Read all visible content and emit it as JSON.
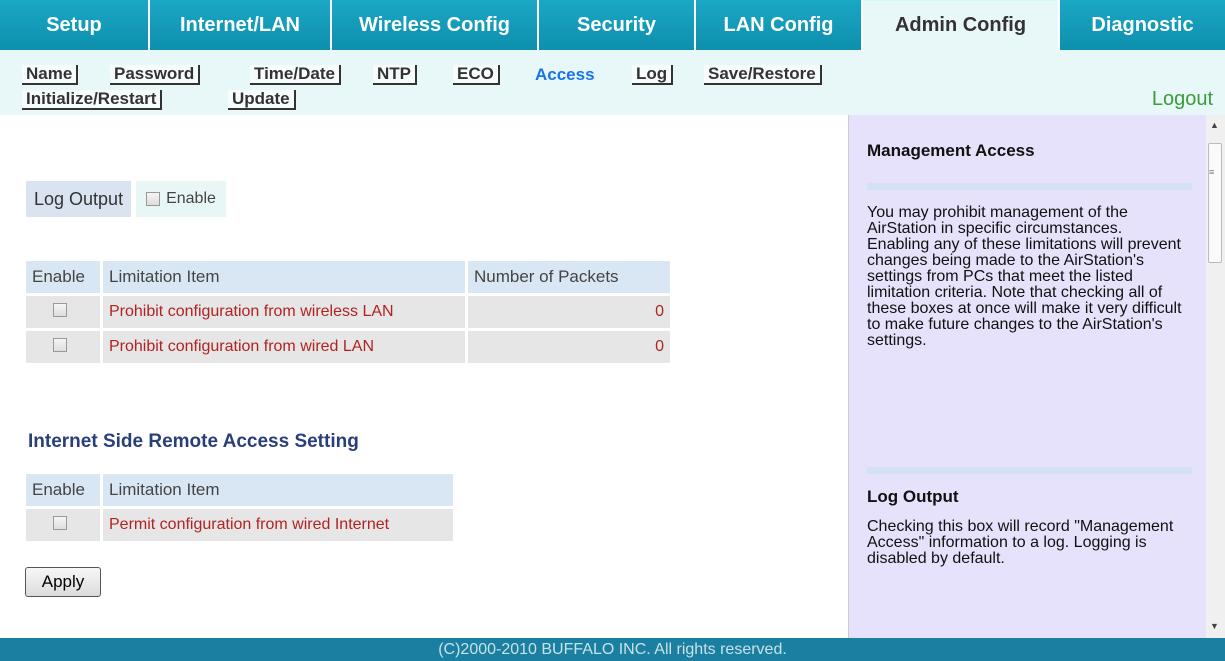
{
  "top_tabs": [
    {
      "label": "Setup"
    },
    {
      "label": "Internet/LAN"
    },
    {
      "label": "Wireless Config"
    },
    {
      "label": "Security"
    },
    {
      "label": "LAN Config"
    },
    {
      "label": "Admin Config",
      "active": true
    },
    {
      "label": "Diagnostic"
    }
  ],
  "sub_tabs": [
    {
      "label": "Name"
    },
    {
      "label": "Password"
    },
    {
      "label": "Time/Date"
    },
    {
      "label": "NTP"
    },
    {
      "label": "ECO"
    },
    {
      "label": "Access",
      "active": true
    },
    {
      "label": "Log"
    },
    {
      "label": "Save/Restore"
    },
    {
      "label": "Initialize/Restart"
    },
    {
      "label": "Update"
    }
  ],
  "logout_label": "Logout",
  "log_output": {
    "label": "Log Output",
    "checkbox_label": "Enable",
    "checked": false
  },
  "limitation_table": {
    "headers": [
      "Enable",
      "Limitation Item",
      "Number of Packets"
    ],
    "rows": [
      {
        "item": "Prohibit configuration from wireless LAN",
        "packets": "0",
        "checked": false
      },
      {
        "item": "Prohibit configuration from wired LAN",
        "packets": "0",
        "checked": false
      }
    ]
  },
  "remote_access": {
    "heading": "Internet Side Remote Access Setting",
    "headers": [
      "Enable",
      "Limitation Item"
    ],
    "rows": [
      {
        "item": "Permit configuration from wired Internet",
        "checked": false
      }
    ]
  },
  "apply_label": "Apply",
  "help": {
    "section1_title": "Management Access",
    "section1_body": "You may prohibit management of the AirStation in specific circumstances. Enabling any of these limitations will prevent changes being made to the AirStation's settings from PCs that meet the listed limitation criteria. Note that checking all of these boxes at once will make it very difficult to make future changes to the AirStation's settings.",
    "section2_title": "Log Output",
    "section2_body": "Checking this box will record \"Management Access\" information to a log. Logging is disabled by default."
  },
  "footer_text": "(C)2000-2010 BUFFALO INC. All rights reserved.",
  "colors": {
    "tab_blue": "#0e8fae",
    "active_sub": "#1a73e8",
    "logout_green": "#3a9c3a",
    "item_red": "#b22222",
    "help_bg": "#e6e2fb",
    "footer_bg": "#1a7fa0"
  }
}
